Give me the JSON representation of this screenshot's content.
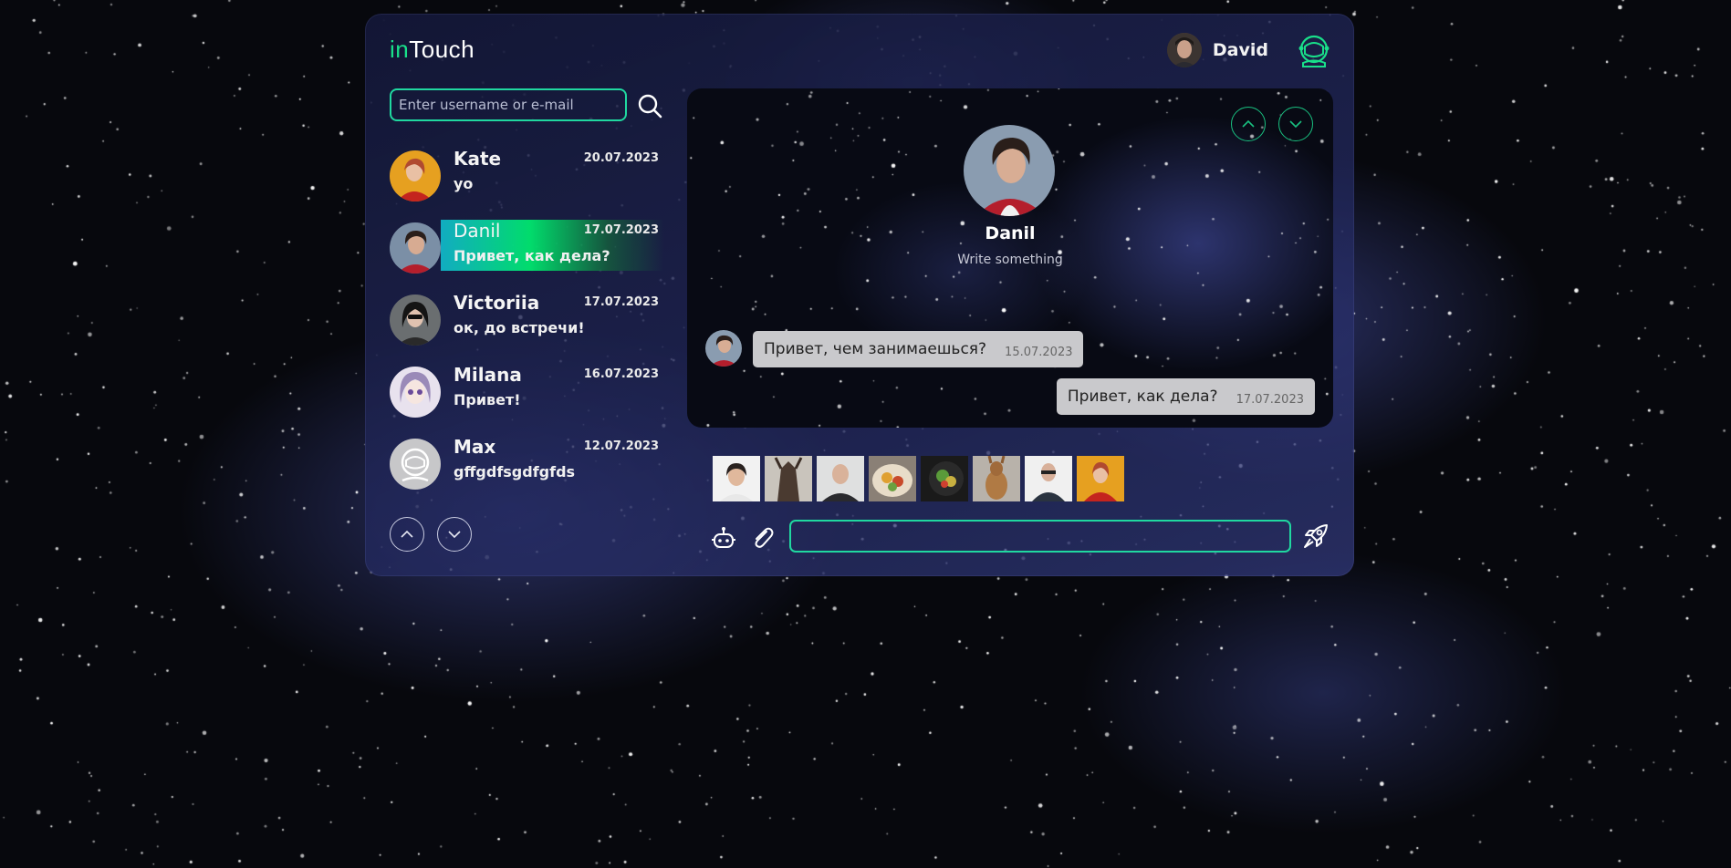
{
  "app": {
    "logo_in": "in",
    "logo_touch": "Touch"
  },
  "user": {
    "name": "David",
    "avatar_icon": "user-avatar",
    "menu_icon": "astronaut-helmet-icon"
  },
  "search": {
    "placeholder": "Enter username or e-mail",
    "value": ""
  },
  "contacts": [
    {
      "name": "Kate",
      "date": "20.07.2023",
      "last_message": "yo",
      "avatar": "kate-avatar",
      "active": false
    },
    {
      "name": "Danil",
      "date": "17.07.2023",
      "last_message": "Привет, как дела?",
      "avatar": "danil-avatar",
      "active": true
    },
    {
      "name": "Victoriia",
      "date": "17.07.2023",
      "last_message": "ок, до встречи!",
      "avatar": "victoriia-avatar",
      "active": false
    },
    {
      "name": "Milana",
      "date": "16.07.2023",
      "last_message": "Привет!",
      "avatar": "milana-avatar",
      "active": false
    },
    {
      "name": "Max",
      "date": "12.07.2023",
      "last_message": "gffgdfsgdfgfds",
      "avatar": "default-helmet-avatar",
      "active": false
    }
  ],
  "chat": {
    "peer_name": "Danil",
    "peer_status": "Write something",
    "messages": [
      {
        "direction": "in",
        "text": "Привет, чем занимаешься?",
        "date": "15.07.2023"
      },
      {
        "direction": "out",
        "text": "Привет, как дела?",
        "date": "17.07.2023"
      }
    ]
  },
  "media_thumbnails": [
    "photo-woman",
    "photo-animal",
    "photo-man-bald",
    "photo-food",
    "photo-salad",
    "photo-kangaroo",
    "photo-man-glasses",
    "photo-woman-red"
  ],
  "composer": {
    "value": "",
    "placeholder": ""
  },
  "colors": {
    "accent": "#20d8a0",
    "accent_green": "#00e66e",
    "accent_cyan": "#11b4c8",
    "bubble": "#c9c9cc"
  },
  "icons": [
    "search-icon",
    "chevron-up-icon",
    "chevron-down-icon",
    "robot-icon",
    "paperclip-icon",
    "rocket-send-icon"
  ]
}
